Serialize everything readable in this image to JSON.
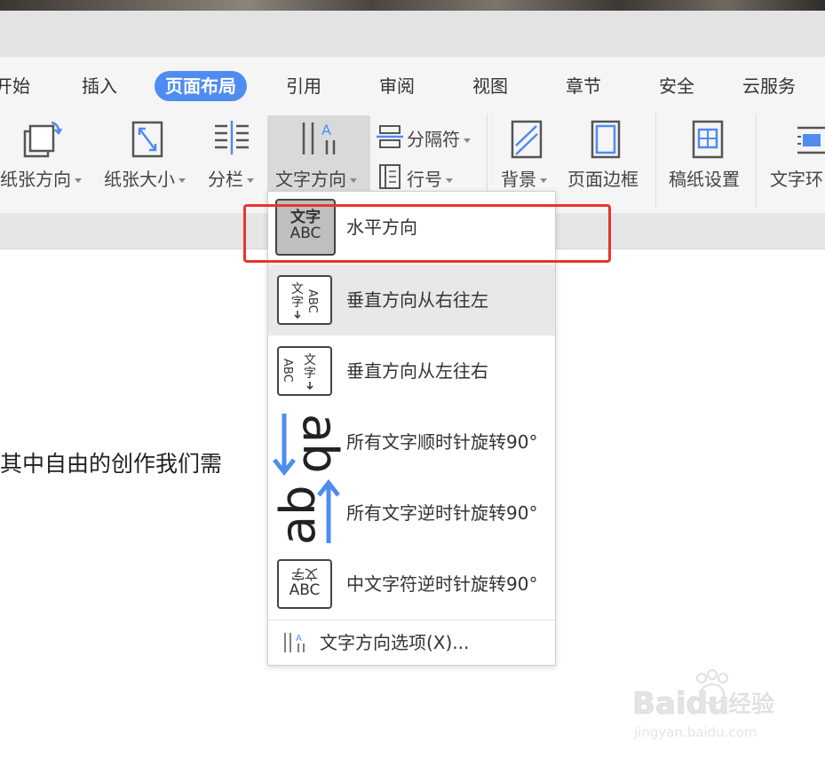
{
  "tabs": [
    "开始",
    "插入",
    "页面布局",
    "引用",
    "审阅",
    "视图",
    "章节",
    "安全",
    "云服务"
  ],
  "active_tab": "页面布局",
  "ribbon": {
    "orientation_label": "纸张方向",
    "size_label": "纸张大小",
    "columns_label": "分栏",
    "text_direction_label": "文字方向",
    "breaks_label": "分隔符",
    "line_numbers_label": "行号",
    "background_label": "背景",
    "page_border_label": "页面边框",
    "manuscript_label": "稿纸设置",
    "text_wrap_label": "文字环"
  },
  "document": {
    "text": "其中自由的创作我们需"
  },
  "dropdown": {
    "items": [
      {
        "label": "水平方向",
        "icon_text_top": "文字",
        "icon_text_bottom": "ABC"
      },
      {
        "label": "垂直方向从右往左"
      },
      {
        "label": "垂直方向从左往右"
      },
      {
        "label": "所有文字顺时针旋转90°"
      },
      {
        "label": "所有文字逆时针旋转90°"
      },
      {
        "label": "中文字符逆时针旋转90°",
        "icon_text_top": "文字",
        "icon_text_bottom": "ABC"
      }
    ],
    "footer_label": "文字方向选项(X)..."
  },
  "highlight_color": "#e8342c",
  "accent_color": "#4e8cf0",
  "watermark": {
    "brand": "Baidu",
    "brand_cn": "经验",
    "url": "jingyan.baidu.com"
  }
}
